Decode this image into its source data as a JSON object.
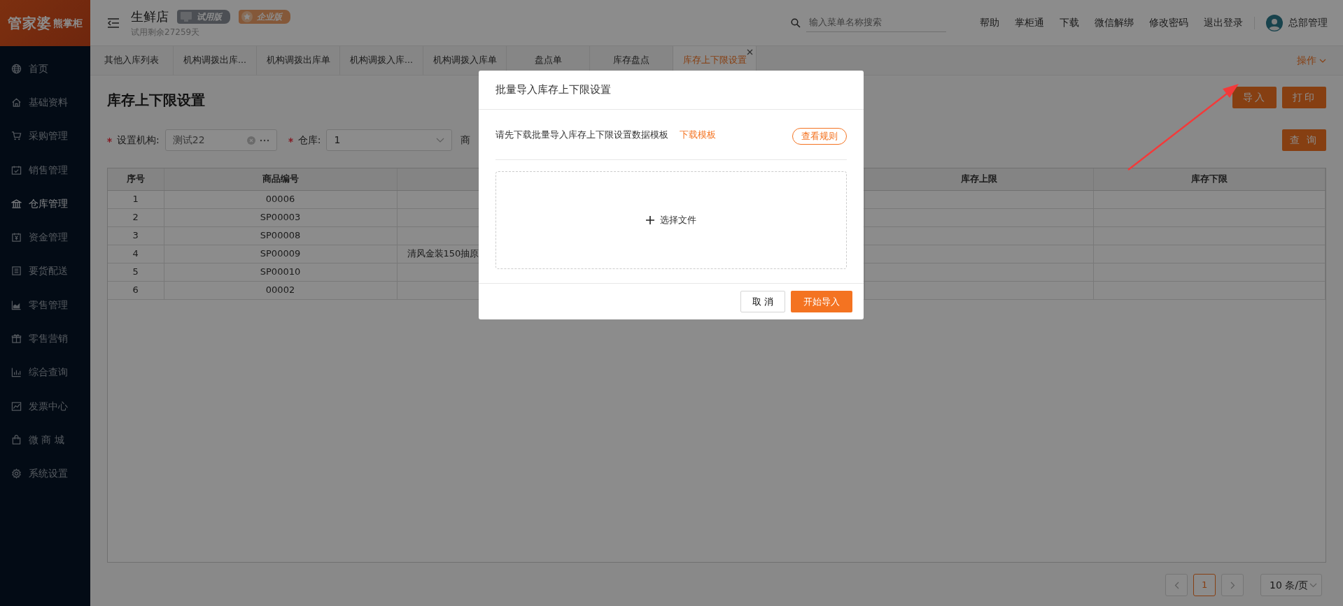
{
  "logo": {
    "main": "管家婆",
    "sub": "熊掌柜"
  },
  "sidebar": {
    "items": [
      {
        "label": "首页",
        "selected": false
      },
      {
        "label": "基础资料",
        "selected": false
      },
      {
        "label": "采购管理",
        "selected": false
      },
      {
        "label": "销售管理",
        "selected": false
      },
      {
        "label": "仓库管理",
        "selected": true
      },
      {
        "label": "资金管理",
        "selected": false
      },
      {
        "label": "要货配送",
        "selected": false
      },
      {
        "label": "零售管理",
        "selected": false
      },
      {
        "label": "零售营销",
        "selected": false
      },
      {
        "label": "综合查询",
        "selected": false
      },
      {
        "label": "发票中心",
        "selected": false
      },
      {
        "label": "微 商 城",
        "selected": false
      },
      {
        "label": "系统设置",
        "selected": false
      }
    ]
  },
  "header": {
    "store": "生鲜店",
    "trial_note": "试用剩余27259天",
    "badges": [
      {
        "label": "试用版",
        "kind": "trial"
      },
      {
        "label": "企业版",
        "kind": "enterprise"
      }
    ],
    "search": {
      "placeholder": "输入菜单名称搜索"
    },
    "links": [
      "帮助",
      "掌柜通",
      "下载",
      "微信解绑",
      "修改密码",
      "退出登录"
    ],
    "user": "总部管理"
  },
  "tabs": [
    {
      "label": "其他入库列表",
      "selected": false,
      "closable": false
    },
    {
      "label": "机构调拨出库...",
      "selected": false,
      "closable": false
    },
    {
      "label": "机构调拨出库单",
      "selected": false,
      "closable": false
    },
    {
      "label": "机构调拨入库...",
      "selected": false,
      "closable": false
    },
    {
      "label": "机构调拨入库单",
      "selected": false,
      "closable": false
    },
    {
      "label": "盘点单",
      "selected": false,
      "closable": false
    },
    {
      "label": "库存盘点",
      "selected": false,
      "closable": false
    },
    {
      "label": "库存上下限设置",
      "selected": true,
      "closable": true
    }
  ],
  "tab_actions": "操作",
  "page": {
    "title": "库存上下限设置",
    "buttons": [
      "导入",
      "打印"
    ],
    "query_button": "查 询",
    "filters": [
      {
        "label": "设置机构:",
        "required": true,
        "value": "测试22",
        "kind": "lookup"
      },
      {
        "label": "仓库:",
        "required": true,
        "value": "1",
        "kind": "select"
      },
      {
        "label": "商",
        "required": false,
        "kind": "covered"
      }
    ]
  },
  "table": {
    "columns": [
      {
        "label": "序号",
        "kind": "index"
      },
      {
        "label": "商品编号",
        "kind": "code"
      },
      {
        "kind": "covered"
      },
      {
        "label": "库存上限",
        "kind": "upper"
      },
      {
        "label": "库存下限",
        "kind": "lower"
      }
    ],
    "rows": [
      {
        "index": "1",
        "code": "00006"
      },
      {
        "index": "2",
        "code": "SP00003"
      },
      {
        "index": "3",
        "code": "SP00008"
      },
      {
        "index": "4",
        "code": "SP00009",
        "name": "清风金装150抽原"
      },
      {
        "index": "5",
        "code": "SP00010"
      },
      {
        "index": "6",
        "code": "00002"
      }
    ]
  },
  "pagination": {
    "pages": [
      {
        "label": "1",
        "selected": true
      }
    ],
    "page_size": "10 条/页"
  },
  "modal": {
    "title": "批量导入库存上下限设置",
    "instruction": "请先下载批量导入库存上下限设置数据模板",
    "template_link": "下载模板",
    "rules_button": "查看规则",
    "dropzone": "选择文件",
    "buttons": [
      {
        "label": "取 消",
        "kind": "cancel"
      },
      {
        "label": "开始导入",
        "kind": "primary"
      }
    ]
  }
}
